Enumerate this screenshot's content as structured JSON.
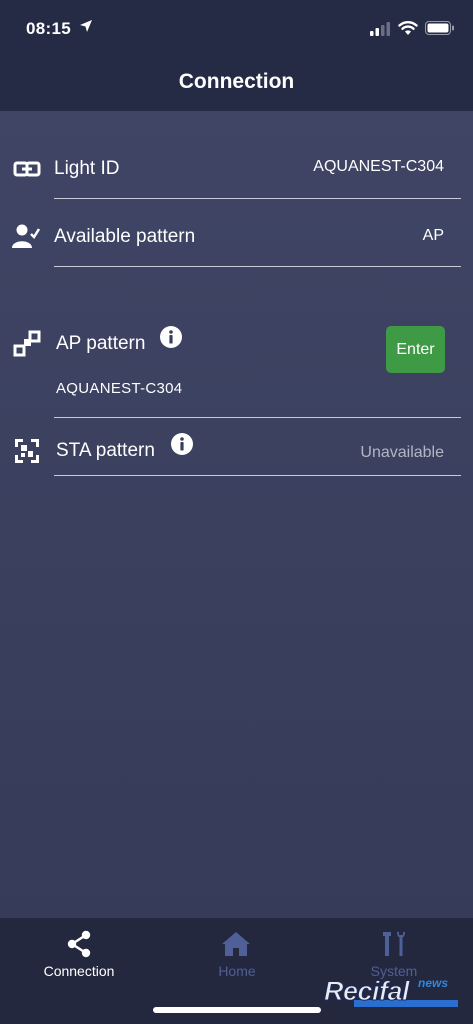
{
  "status_bar": {
    "time": "08:15"
  },
  "header": {
    "title": "Connection"
  },
  "rows": {
    "light_id": {
      "label": "Light ID",
      "value": "AQUANEST-C304"
    },
    "available_pattern": {
      "label": "Available pattern",
      "value": "AP"
    },
    "ap_pattern": {
      "label": "AP pattern",
      "sub_value": "AQUANEST-C304",
      "button_label": "Enter"
    },
    "sta_pattern": {
      "label": "STA pattern",
      "value": "Unavailable"
    }
  },
  "tabbar": {
    "tabs": [
      {
        "label": "Connection",
        "icon": "share-icon",
        "active": true
      },
      {
        "label": "Home",
        "icon": "home-icon",
        "active": false
      },
      {
        "label": "System",
        "icon": "tools-icon",
        "active": false
      }
    ]
  },
  "watermark": {
    "text": "Recifal",
    "news": "news"
  },
  "colors": {
    "header_bg": "#262b45",
    "content_bg": "#3a3f5e",
    "tabbar_bg": "#23283f",
    "enter_button": "#3f9a46",
    "inactive_tab": "#4f5f98"
  }
}
